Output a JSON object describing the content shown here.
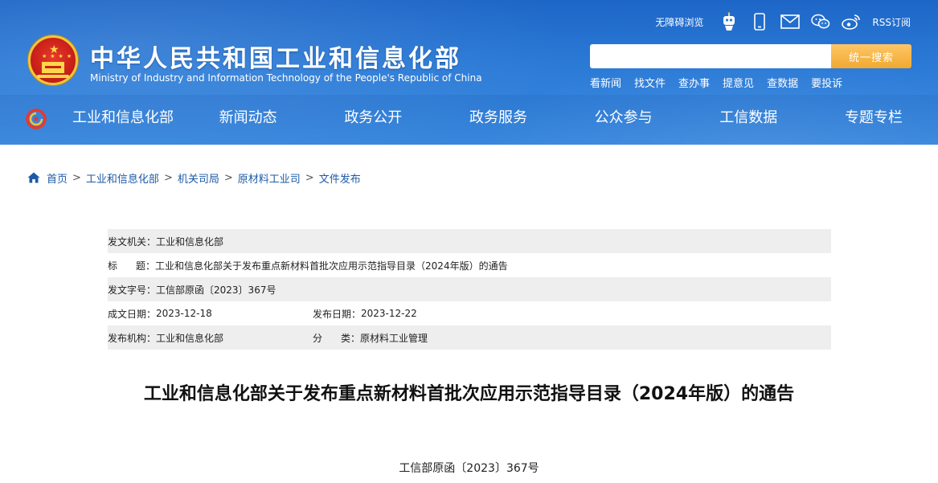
{
  "header": {
    "site_title": "中华人民共和国工业和信息化部",
    "site_subtitle": "Ministry of Industry and Information Technology of the People's Republic of China",
    "accessibility_label": "无障碍浏览",
    "rss_label": "RSS订阅",
    "icons": [
      "robot-icon",
      "mobile-icon",
      "mail-icon",
      "wechat-icon",
      "weibo-icon"
    ]
  },
  "search": {
    "placeholder": "",
    "button_label": "统一搜索"
  },
  "quick_links": [
    "看新闻",
    "找文件",
    "查办事",
    "提意见",
    "查数据",
    "要投诉"
  ],
  "nav": [
    "工业和信息化部",
    "新闻动态",
    "政务公开",
    "政务服务",
    "公众参与",
    "工信数据",
    "专题专栏"
  ],
  "breadcrumb": {
    "items": [
      "首页",
      "工业和信息化部",
      "机关司局",
      "原材料工业司",
      "文件发布"
    ],
    "separator": ">"
  },
  "meta": {
    "issuer_label": "发文机关：",
    "issuer": "工业和信息化部",
    "title_label_a": "标",
    "title_label_b": "题：",
    "title": "工业和信息化部关于发布重点新材料首批次应用示范指导目录（2024年版）的通告",
    "doc_no_label": "发文字号：",
    "doc_no": "工信部原函〔2023〕367号",
    "created_label": "成文日期：",
    "created": "2023-12-18",
    "published_label": "发布日期：",
    "published": "2023-12-22",
    "org_label": "发布机构：",
    "org": "工业和信息化部",
    "category_label_a": "分",
    "category_label_b": "类：",
    "category": "原材料工业管理"
  },
  "article": {
    "title": "工业和信息化部关于发布重点新材料首批次应用示范指导目录（2024年版）的通告",
    "doc_number": "工信部原函〔2023〕367号"
  },
  "colors": {
    "header_blue": "#2b7ad6",
    "search_button": "#f0a830",
    "link_blue": "#1d5aa6",
    "row_shade": "#eeeeee"
  }
}
